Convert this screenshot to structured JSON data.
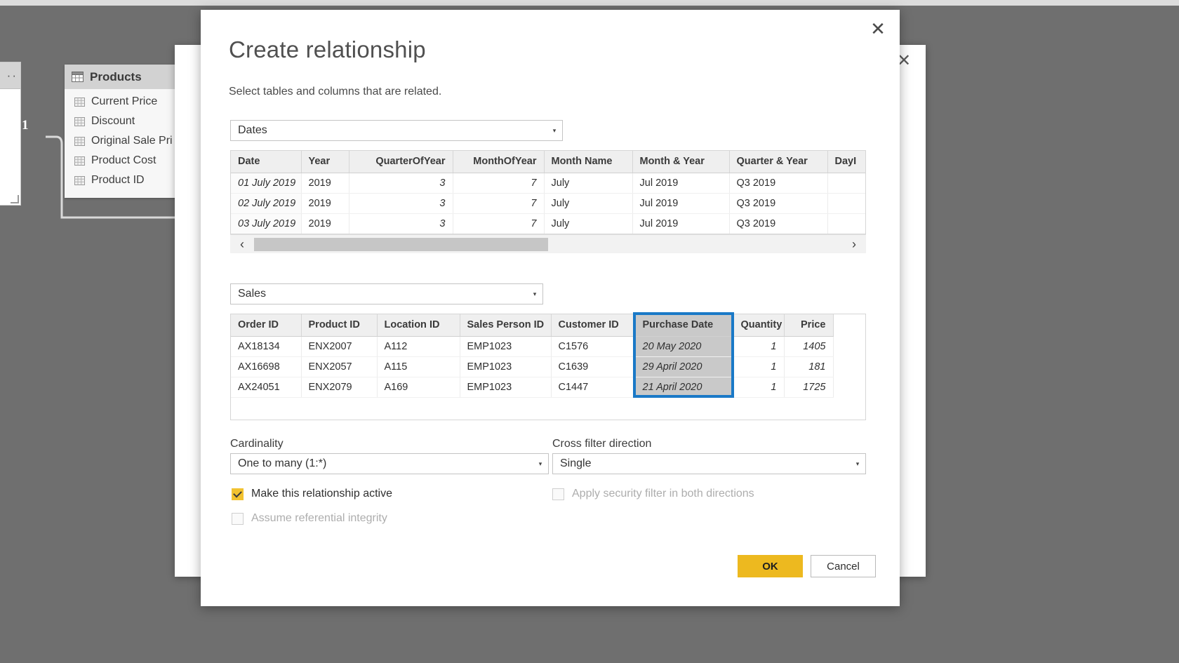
{
  "canvas": {
    "products_card": {
      "title": "Products",
      "icon": "table-icon",
      "fields": [
        "Current Price",
        "Discount",
        "Original Sale Pri",
        "Product Cost",
        "Product ID"
      ]
    },
    "relationship_cardinality_label": "1",
    "cursor": "mouse-pointer"
  },
  "behind_panel": {
    "close_label": "✕"
  },
  "dialog": {
    "close_label": "✕",
    "title": "Create relationship",
    "subtitle": "Select tables and columns that are related.",
    "table1": {
      "selected": "Dates",
      "caret": "▾",
      "columns": [
        "Date",
        "Year",
        "QuarterOfYear",
        "MonthOfYear",
        "Month Name",
        "Month & Year",
        "Quarter & Year",
        "DayI"
      ],
      "rows": [
        [
          "01 July 2019",
          "2019",
          "3",
          "7",
          "July",
          "Jul 2019",
          "Q3 2019",
          ""
        ],
        [
          "02 July 2019",
          "2019",
          "3",
          "7",
          "July",
          "Jul 2019",
          "Q3 2019",
          ""
        ],
        [
          "03 July 2019",
          "2019",
          "3",
          "7",
          "July",
          "Jul 2019",
          "Q3 2019",
          ""
        ]
      ],
      "scroll_left_label": "‹",
      "scroll_right_label": "›"
    },
    "table2": {
      "selected": "Sales",
      "caret": "▾",
      "columns": [
        "Order ID",
        "Product ID",
        "Location ID",
        "Sales Person ID",
        "Customer ID",
        "Purchase Date",
        "Quantity",
        "Price"
      ],
      "highlighted_column": "Purchase Date",
      "rows": [
        [
          "AX18134",
          "ENX2007",
          "A112",
          "EMP1023",
          "C1576",
          "20 May 2020",
          "1",
          "1405"
        ],
        [
          "AX16698",
          "ENX2057",
          "A115",
          "EMP1023",
          "C1639",
          "29 April 2020",
          "1",
          "181"
        ],
        [
          "AX24051",
          "ENX2079",
          "A169",
          "EMP1023",
          "C1447",
          "21 April 2020",
          "1",
          "1725"
        ]
      ]
    },
    "cardinality": {
      "label": "Cardinality",
      "selected": "One to many (1:*)",
      "caret": "▾"
    },
    "cross_filter": {
      "label": "Cross filter direction",
      "selected": "Single",
      "caret": "▾"
    },
    "checkboxes": {
      "make_active": {
        "label": "Make this relationship active",
        "checked": true,
        "disabled": false
      },
      "apply_security": {
        "label": "Apply security filter in both directions",
        "checked": false,
        "disabled": true
      },
      "assume_integrity": {
        "label": "Assume referential integrity",
        "checked": false,
        "disabled": true
      }
    },
    "buttons": {
      "ok": "OK",
      "cancel": "Cancel"
    },
    "colors": {
      "accent": "#edb91f",
      "highlight": "#1a79c7",
      "checkbox_checked": "#f2c230"
    }
  }
}
